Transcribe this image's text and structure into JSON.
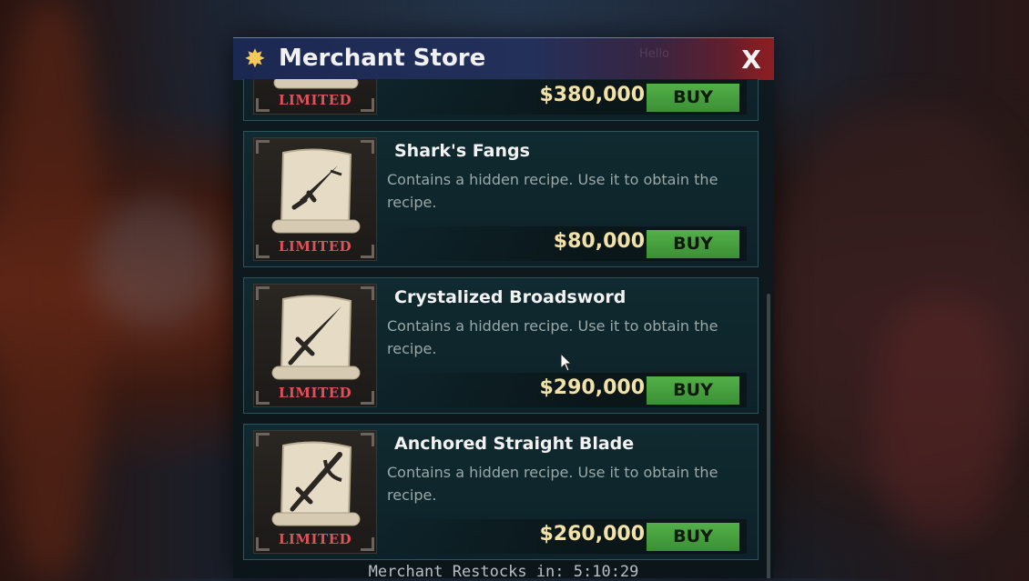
{
  "window": {
    "title": "Merchant Store",
    "title_icon": "sunburst-icon",
    "close_label": "X",
    "faint_header_text": "Hello"
  },
  "items": [
    {
      "name": "",
      "description": "",
      "badge": "LIMITED",
      "price": "$380,000",
      "buy_label": "BUY",
      "icon": "scroll-recipe-icon"
    },
    {
      "name": "Shark's Fangs",
      "description": "Contains a hidden recipe. Use it to obtain the recipe.",
      "badge": "LIMITED",
      "price": "$80,000",
      "buy_label": "BUY",
      "icon": "scroll-dagger-icon"
    },
    {
      "name": "Crystalized Broadsword",
      "description": "Contains a hidden recipe. Use it to obtain the recipe.",
      "badge": "LIMITED",
      "price": "$290,000",
      "buy_label": "BUY",
      "icon": "scroll-sword-icon"
    },
    {
      "name": "Anchored Straight Blade",
      "description": "Contains a hidden recipe. Use it to obtain the recipe.",
      "badge": "LIMITED",
      "price": "$260,000",
      "buy_label": "BUY",
      "icon": "scroll-anchor-blade-icon"
    }
  ],
  "footer": {
    "restock_text": "Merchant Restocks in: 5:10:29"
  },
  "colors": {
    "accent_buy": "#4aa640",
    "limited_red": "#e0505a",
    "price_gold": "#f2e2a8",
    "title_bar_blue": "#1b2852",
    "close_red": "#8a1e24"
  }
}
